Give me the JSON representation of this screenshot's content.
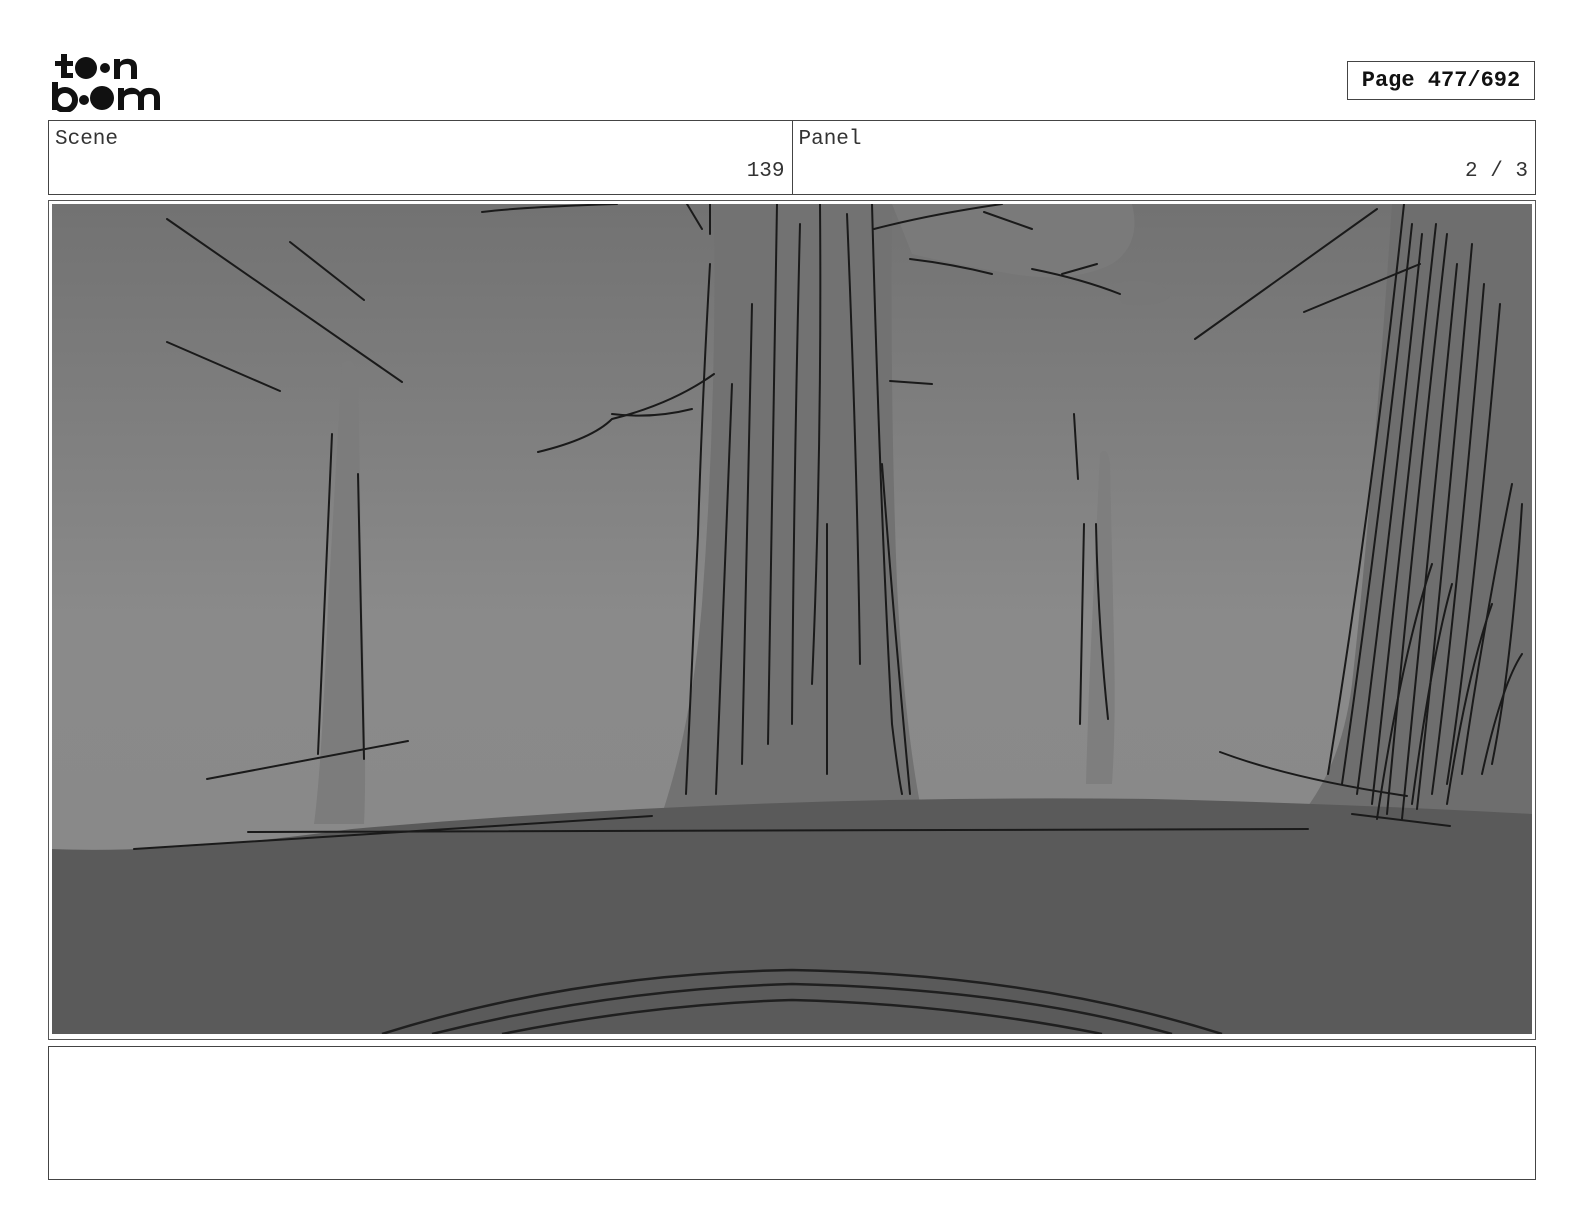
{
  "header": {
    "logo_text": "toonboom",
    "page_label": "Page 477/692"
  },
  "info": {
    "scene_label": "Scene",
    "scene_value": "139",
    "panel_label": "Panel",
    "panel_value": "2 / 3"
  },
  "panel_image": {
    "icon": "storyboard-sketch-forest-trees"
  },
  "notes": {
    "text": ""
  }
}
